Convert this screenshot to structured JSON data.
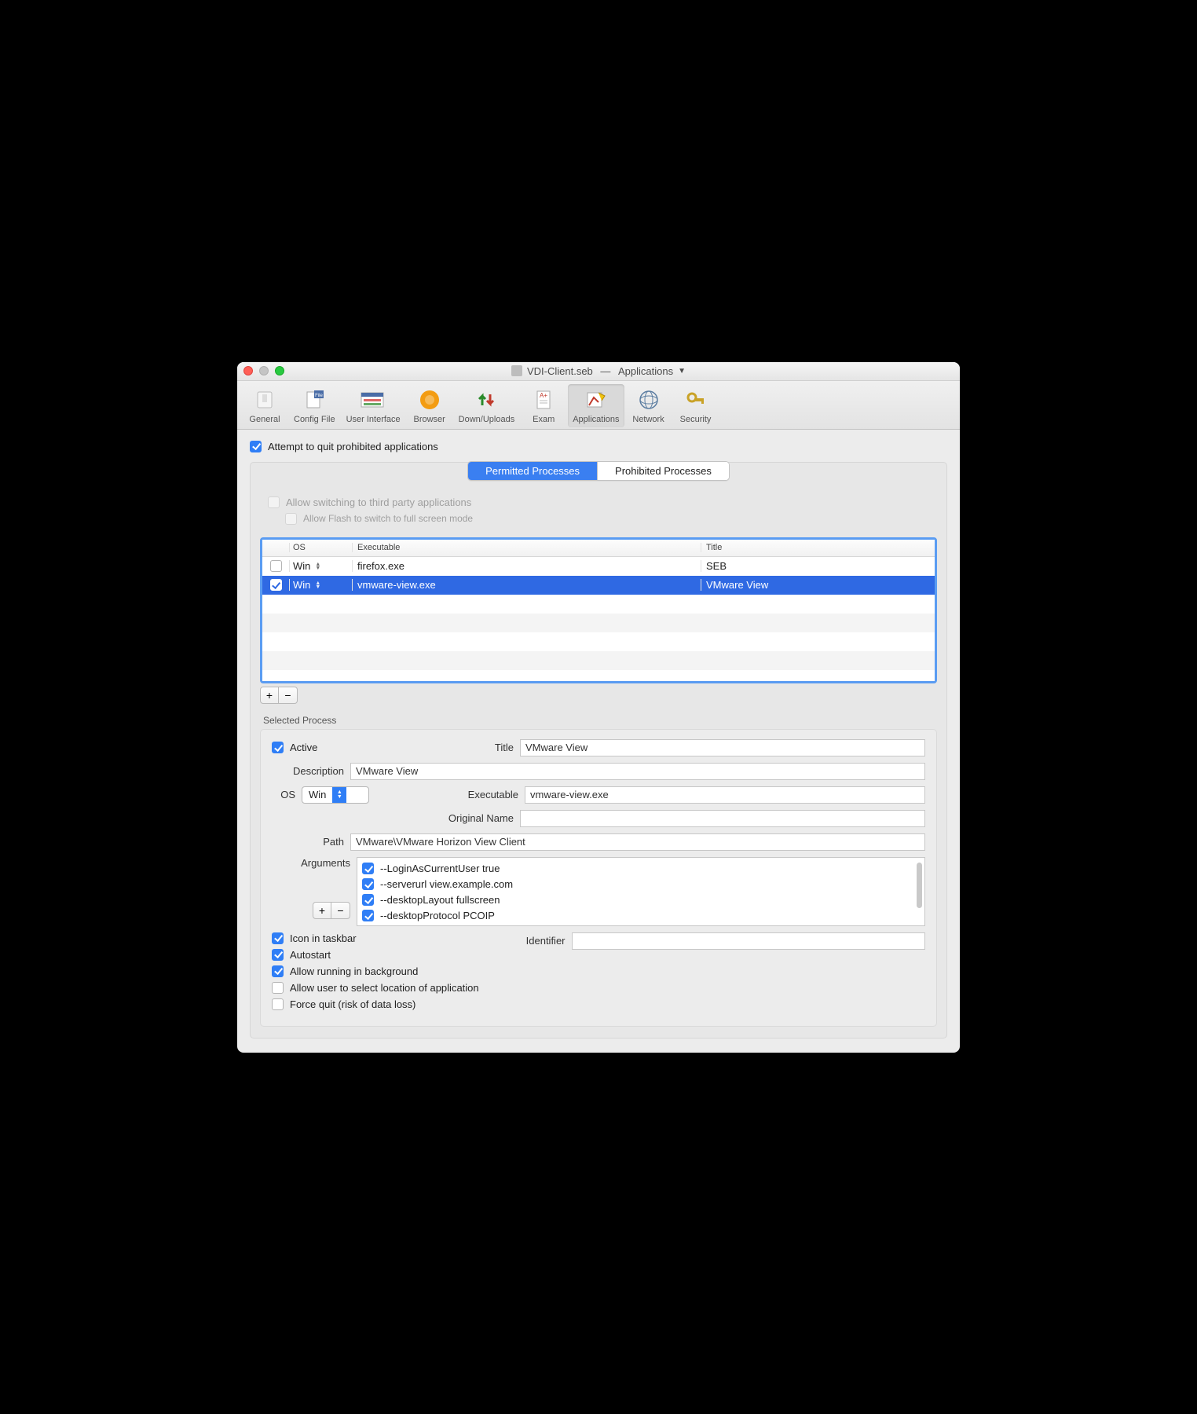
{
  "window": {
    "filename": "VDI-Client.seb",
    "section": "Applications"
  },
  "toolbar": {
    "items": [
      {
        "label": "General"
      },
      {
        "label": "Config File"
      },
      {
        "label": "User Interface"
      },
      {
        "label": "Browser"
      },
      {
        "label": "Down/Uploads"
      },
      {
        "label": "Exam"
      },
      {
        "label": "Applications"
      },
      {
        "label": "Network"
      },
      {
        "label": "Security"
      }
    ],
    "activeIndex": 6
  },
  "options": {
    "attempt_quit_label": "Attempt to quit prohibited applications",
    "attempt_quit_checked": true
  },
  "tabs": {
    "permitted": "Permitted Processes",
    "prohibited": "Prohibited Processes"
  },
  "subopts": {
    "allow_switch_label": "Allow switching to third party applications",
    "allow_switch_checked": false,
    "allow_flash_label": "Allow Flash to switch to full screen mode",
    "allow_flash_checked": false
  },
  "table": {
    "headers": {
      "os": "OS",
      "exe": "Executable",
      "title": "Title"
    },
    "rows": [
      {
        "checked": false,
        "os": "Win",
        "exe": "firefox.exe",
        "title": "SEB",
        "selected": false
      },
      {
        "checked": true,
        "os": "Win",
        "exe": "vmware-view.exe",
        "title": "VMware View",
        "selected": true
      }
    ]
  },
  "buttons": {
    "plus": "+",
    "minus": "−"
  },
  "selected_process_label": "Selected Process",
  "form": {
    "active_label": "Active",
    "active_checked": true,
    "title_label": "Title",
    "title_value": "VMware View",
    "description_label": "Description",
    "description_value": "VMware View",
    "os_label": "OS",
    "os_value": "Win",
    "executable_label": "Executable",
    "executable_value": "vmware-view.exe",
    "original_label": "Original Name",
    "original_value": "",
    "path_label": "Path",
    "path_value": "VMware\\VMware Horizon View Client",
    "arguments_label": "Arguments",
    "arguments": [
      {
        "checked": true,
        "text": "--LoginAsCurrentUser true"
      },
      {
        "checked": true,
        "text": "--serverurl view.example.com"
      },
      {
        "checked": true,
        "text": "--desktopLayout fullscreen"
      },
      {
        "checked": true,
        "text": "--desktopProtocol PCOIP"
      }
    ],
    "identifier_label": "Identifier",
    "identifier_value": "",
    "icon_taskbar_label": "Icon in taskbar",
    "icon_taskbar_checked": true,
    "autostart_label": "Autostart",
    "autostart_checked": true,
    "allow_bg_label": "Allow running in background",
    "allow_bg_checked": true,
    "allow_loc_label": "Allow user to select location of application",
    "allow_loc_checked": false,
    "force_quit_label": "Force quit (risk of data loss)",
    "force_quit_checked": false
  }
}
